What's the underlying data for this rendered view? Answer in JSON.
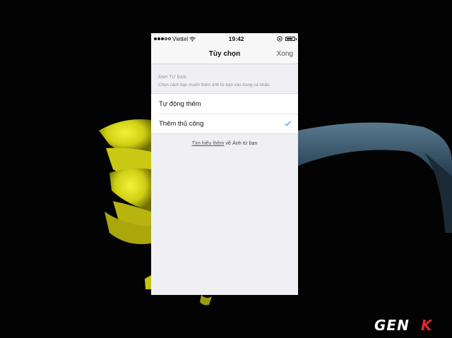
{
  "status_bar": {
    "carrier": "Viettel",
    "time": "19:42",
    "signal_bars": 3,
    "battery_level": 0.75
  },
  "nav": {
    "title": "Tùy chọn",
    "done_label": "Xong"
  },
  "section": {
    "header": "ẢNH TỪ BẠN",
    "description": "Chọn cách bạn muốn thêm ảnh từ bạn vào trang cá nhân."
  },
  "options": [
    {
      "label": "Tự động thêm",
      "selected": false
    },
    {
      "label": "Thêm thủ công",
      "selected": true
    }
  ],
  "footer": {
    "link_text": "Tìm hiểu thêm",
    "rest_text": " về Ảnh từ bạn"
  },
  "watermark": {
    "text": "GENK"
  },
  "colors": {
    "accent": "#3897f0",
    "background": "#000000",
    "flower_yellow": "#e8e61c",
    "stem_blue": "#2f4a5c"
  }
}
